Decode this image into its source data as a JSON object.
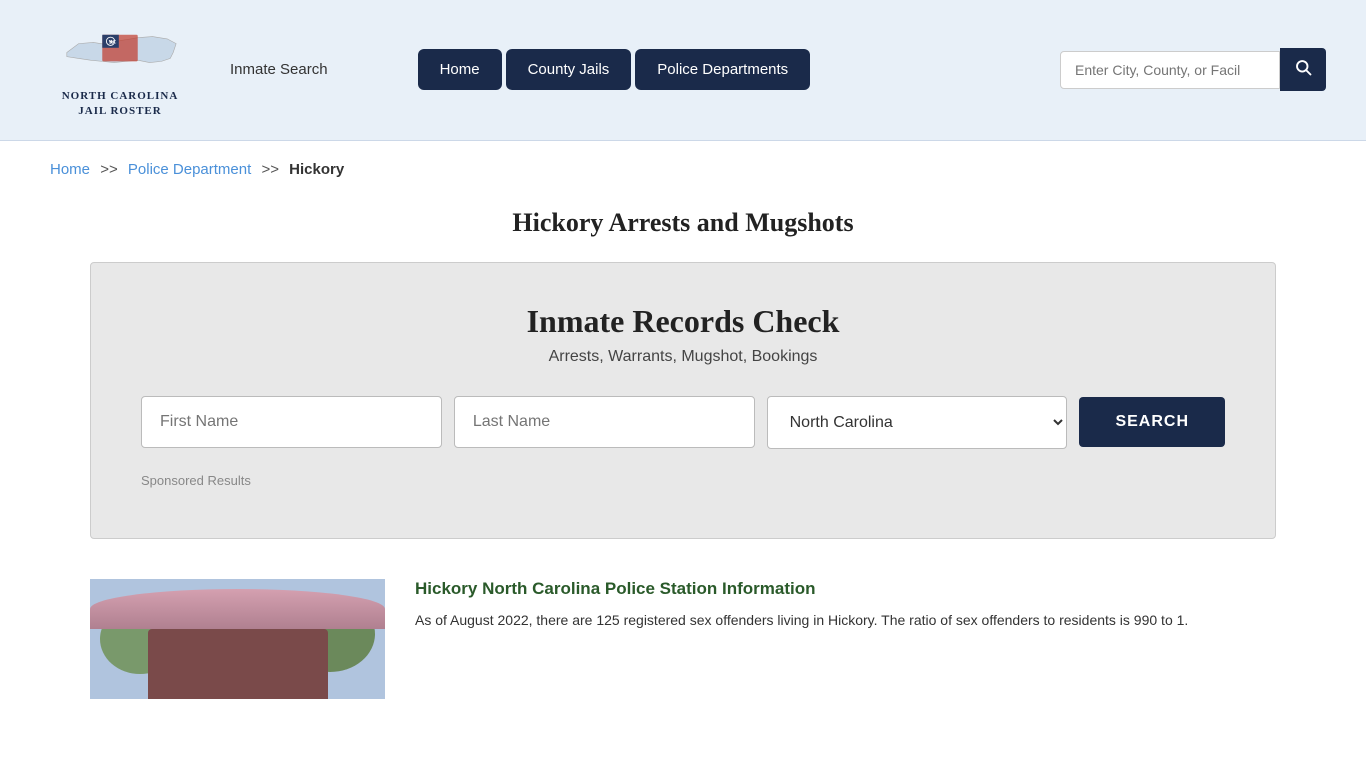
{
  "header": {
    "logo_title_line1": "NORTH CAROLINA",
    "logo_title_line2": "JAIL ROSTER",
    "inmate_search_label": "Inmate Search",
    "nav": {
      "home_label": "Home",
      "county_jails_label": "County Jails",
      "police_departments_label": "Police Departments"
    },
    "search_placeholder": "Enter City, County, or Facil"
  },
  "breadcrumb": {
    "home_label": "Home",
    "sep1": ">>",
    "police_department_label": "Police Department",
    "sep2": ">>",
    "current_label": "Hickory"
  },
  "page_title": "Hickory Arrests and Mugshots",
  "records_check": {
    "title": "Inmate Records Check",
    "subtitle": "Arrests, Warrants, Mugshot, Bookings",
    "first_name_placeholder": "First Name",
    "last_name_placeholder": "Last Name",
    "state_default": "North Carolina",
    "search_button_label": "SEARCH",
    "sponsored_label": "Sponsored Results"
  },
  "article": {
    "title": "Hickory North Carolina Police Station Information",
    "text": "As of August 2022, there are 125 registered sex offenders living in Hickory. The ratio of sex offenders to residents is 990 to 1."
  }
}
